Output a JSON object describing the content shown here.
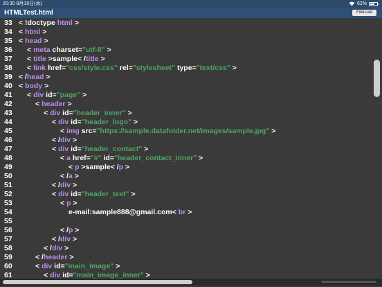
{
  "status": {
    "time": "20:30",
    "date": "8月19日(水)",
    "battery": "62%",
    "battery_level": 0.62
  },
  "app": {
    "title": "HTMLTest.html",
    "fileload_label": "FileLoad"
  },
  "colors": {
    "tag": "#c08cf0",
    "string": "#4fa564",
    "text": "#ffffff",
    "background": "#3a3a3a"
  },
  "code_lines": [
    {
      "n": "33",
      "indent": 0,
      "tokens": [
        {
          "t": "plain",
          "v": "< !doctype "
        },
        {
          "t": "tag",
          "v": "html"
        },
        {
          "t": "plain",
          "v": " >"
        }
      ]
    },
    {
      "n": "34",
      "indent": 0,
      "tokens": [
        {
          "t": "plain",
          "v": "< "
        },
        {
          "t": "tag",
          "v": "html"
        },
        {
          "t": "plain",
          "v": " >"
        }
      ]
    },
    {
      "n": "35",
      "indent": 0,
      "tokens": [
        {
          "t": "plain",
          "v": "< "
        },
        {
          "t": "tag",
          "v": "head"
        },
        {
          "t": "plain",
          "v": " >"
        }
      ]
    },
    {
      "n": "36",
      "indent": 1,
      "tokens": [
        {
          "t": "plain",
          "v": "< "
        },
        {
          "t": "tag",
          "v": "meta"
        },
        {
          "t": "plain",
          "v": " charset="
        },
        {
          "t": "str",
          "v": "\"utf-8\""
        },
        {
          "t": "plain",
          "v": " >"
        }
      ]
    },
    {
      "n": "37",
      "indent": 1,
      "tokens": [
        {
          "t": "plain",
          "v": "< "
        },
        {
          "t": "tag",
          "v": "title"
        },
        {
          "t": "plain",
          "v": " >sample< /"
        },
        {
          "t": "tag",
          "v": "title"
        },
        {
          "t": "plain",
          "v": " >"
        }
      ]
    },
    {
      "n": "38",
      "indent": 1,
      "tokens": [
        {
          "t": "plain",
          "v": "< "
        },
        {
          "t": "tag",
          "v": "link"
        },
        {
          "t": "plain",
          "v": " href="
        },
        {
          "t": "str",
          "v": "\"css/style.css\""
        },
        {
          "t": "plain",
          "v": " rel="
        },
        {
          "t": "str",
          "v": "\"stylesheet\""
        },
        {
          "t": "plain",
          "v": " type="
        },
        {
          "t": "str",
          "v": "\"text/css\""
        },
        {
          "t": "plain",
          "v": " >"
        }
      ]
    },
    {
      "n": "39",
      "indent": 0,
      "tokens": [
        {
          "t": "plain",
          "v": "< /"
        },
        {
          "t": "tag",
          "v": "head"
        },
        {
          "t": "plain",
          "v": " >"
        }
      ]
    },
    {
      "n": "40",
      "indent": 0,
      "tokens": [
        {
          "t": "plain",
          "v": "< "
        },
        {
          "t": "tag",
          "v": "body"
        },
        {
          "t": "plain",
          "v": " >"
        }
      ]
    },
    {
      "n": "41",
      "indent": 1,
      "tokens": [
        {
          "t": "plain",
          "v": "< "
        },
        {
          "t": "tag",
          "v": "div"
        },
        {
          "t": "plain",
          "v": " id="
        },
        {
          "t": "str",
          "v": "\"page\""
        },
        {
          "t": "plain",
          "v": " >"
        }
      ]
    },
    {
      "n": "42",
      "indent": 2,
      "tokens": [
        {
          "t": "plain",
          "v": "< "
        },
        {
          "t": "tag",
          "v": "header"
        },
        {
          "t": "plain",
          "v": " >"
        }
      ]
    },
    {
      "n": "43",
      "indent": 3,
      "tokens": [
        {
          "t": "plain",
          "v": "< "
        },
        {
          "t": "tag",
          "v": "div"
        },
        {
          "t": "plain",
          "v": " id="
        },
        {
          "t": "str",
          "v": "\"header_inner\""
        },
        {
          "t": "plain",
          "v": " >"
        }
      ]
    },
    {
      "n": "44",
      "indent": 4,
      "tokens": [
        {
          "t": "plain",
          "v": "< "
        },
        {
          "t": "tag",
          "v": "div"
        },
        {
          "t": "plain",
          "v": " id="
        },
        {
          "t": "str",
          "v": "\"header_logo\""
        },
        {
          "t": "plain",
          "v": " >"
        }
      ]
    },
    {
      "n": "45",
      "indent": 5,
      "tokens": [
        {
          "t": "plain",
          "v": "< "
        },
        {
          "t": "tag",
          "v": "img"
        },
        {
          "t": "plain",
          "v": " src="
        },
        {
          "t": "str",
          "v": "\"https://sample.datafolder.net/images/sample.jpg\""
        },
        {
          "t": "plain",
          "v": " >"
        }
      ]
    },
    {
      "n": "46",
      "indent": 4,
      "tokens": [
        {
          "t": "plain",
          "v": "< /"
        },
        {
          "t": "tag",
          "v": "div"
        },
        {
          "t": "plain",
          "v": " >"
        }
      ]
    },
    {
      "n": "47",
      "indent": 4,
      "tokens": [
        {
          "t": "plain",
          "v": "< "
        },
        {
          "t": "tag",
          "v": "div"
        },
        {
          "t": "plain",
          "v": " id="
        },
        {
          "t": "str",
          "v": "\"header_contact\""
        },
        {
          "t": "plain",
          "v": " >"
        }
      ]
    },
    {
      "n": "48",
      "indent": 5,
      "tokens": [
        {
          "t": "plain",
          "v": "< "
        },
        {
          "t": "tag",
          "v": "a"
        },
        {
          "t": "plain",
          "v": " href="
        },
        {
          "t": "str",
          "v": "\"#\""
        },
        {
          "t": "plain",
          "v": " id="
        },
        {
          "t": "str",
          "v": "\"header_contact_inner\""
        },
        {
          "t": "plain",
          "v": " >"
        }
      ]
    },
    {
      "n": "49",
      "indent": 6,
      "tokens": [
        {
          "t": "plain",
          "v": "< "
        },
        {
          "t": "tag",
          "v": "p"
        },
        {
          "t": "plain",
          "v": " >sample< /"
        },
        {
          "t": "tag",
          "v": "p"
        },
        {
          "t": "plain",
          "v": " >"
        }
      ]
    },
    {
      "n": "50",
      "indent": 5,
      "tokens": [
        {
          "t": "plain",
          "v": "< /"
        },
        {
          "t": "tag",
          "v": "a"
        },
        {
          "t": "plain",
          "v": " >"
        }
      ]
    },
    {
      "n": "51",
      "indent": 4,
      "tokens": [
        {
          "t": "plain",
          "v": "< /"
        },
        {
          "t": "tag",
          "v": "div"
        },
        {
          "t": "plain",
          "v": " >"
        }
      ]
    },
    {
      "n": "52",
      "indent": 4,
      "tokens": [
        {
          "t": "plain",
          "v": "< "
        },
        {
          "t": "tag",
          "v": "div"
        },
        {
          "t": "plain",
          "v": " id="
        },
        {
          "t": "str",
          "v": "\"header_text\""
        },
        {
          "t": "plain",
          "v": " >"
        }
      ]
    },
    {
      "n": "53",
      "indent": 5,
      "tokens": [
        {
          "t": "plain",
          "v": "< "
        },
        {
          "t": "tag",
          "v": "p"
        },
        {
          "t": "plain",
          "v": " >"
        }
      ]
    },
    {
      "n": "54",
      "indent": 6,
      "tokens": [
        {
          "t": "plain",
          "v": "e-mail:sample888@gmail.com< "
        },
        {
          "t": "tag",
          "v": "br"
        },
        {
          "t": "plain",
          "v": " >"
        }
      ]
    },
    {
      "n": "55",
      "indent": 0,
      "tokens": []
    },
    {
      "n": "56",
      "indent": 5,
      "tokens": [
        {
          "t": "plain",
          "v": "< /"
        },
        {
          "t": "tag",
          "v": "p"
        },
        {
          "t": "plain",
          "v": " >"
        }
      ]
    },
    {
      "n": "57",
      "indent": 4,
      "tokens": [
        {
          "t": "plain",
          "v": "< /"
        },
        {
          "t": "tag",
          "v": "div"
        },
        {
          "t": "plain",
          "v": " >"
        }
      ]
    },
    {
      "n": "58",
      "indent": 3,
      "tokens": [
        {
          "t": "plain",
          "v": "< /"
        },
        {
          "t": "tag",
          "v": "div"
        },
        {
          "t": "plain",
          "v": " >"
        }
      ]
    },
    {
      "n": "59",
      "indent": 2,
      "tokens": [
        {
          "t": "plain",
          "v": "< /"
        },
        {
          "t": "tag",
          "v": "header"
        },
        {
          "t": "plain",
          "v": " >"
        }
      ]
    },
    {
      "n": "60",
      "indent": 2,
      "tokens": [
        {
          "t": "plain",
          "v": "< "
        },
        {
          "t": "tag",
          "v": "div"
        },
        {
          "t": "plain",
          "v": " id="
        },
        {
          "t": "str",
          "v": "\"main_image\""
        },
        {
          "t": "plain",
          "v": " >"
        }
      ]
    },
    {
      "n": "61",
      "indent": 3,
      "tokens": [
        {
          "t": "plain",
          "v": "< "
        },
        {
          "t": "tag",
          "v": "div"
        },
        {
          "t": "plain",
          "v": " id="
        },
        {
          "t": "str",
          "v": "\"main_image_inner\""
        },
        {
          "t": "plain",
          "v": " >"
        }
      ]
    }
  ]
}
